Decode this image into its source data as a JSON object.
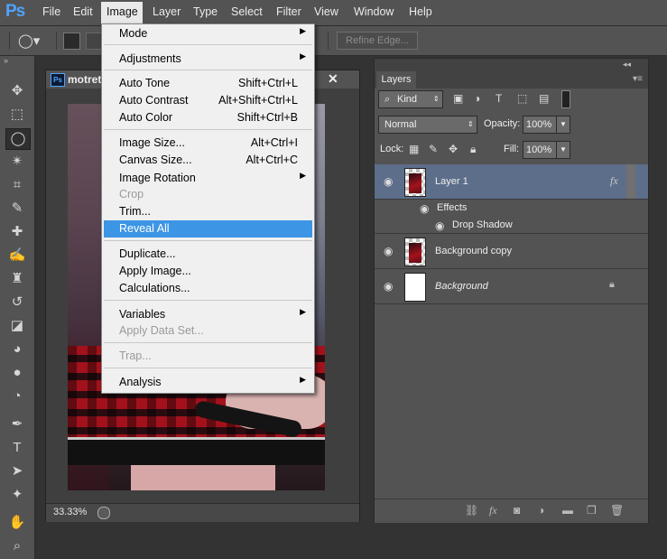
{
  "app": {
    "logo": "Ps"
  },
  "menubar": {
    "items": [
      "File",
      "Edit",
      "Image",
      "Layer",
      "Type",
      "Select",
      "Filter",
      "View",
      "Window",
      "Help"
    ],
    "active": "Image"
  },
  "options_bar": {
    "refine_edge": "Refine Edge..."
  },
  "document": {
    "title": "motret",
    "close": "✕",
    "zoom": "33.33%"
  },
  "image_menu": {
    "items": [
      {
        "label": "Mode",
        "submenu": true
      },
      {
        "label": "Adjustments",
        "submenu": true
      },
      {
        "label": "Auto Tone",
        "shortcut": "Shift+Ctrl+L"
      },
      {
        "label": "Auto Contrast",
        "shortcut": "Alt+Shift+Ctrl+L"
      },
      {
        "label": "Auto Color",
        "shortcut": "Shift+Ctrl+B"
      },
      {
        "label": "Image Size...",
        "shortcut": "Alt+Ctrl+I"
      },
      {
        "label": "Canvas Size...",
        "shortcut": "Alt+Ctrl+C"
      },
      {
        "label": "Image Rotation",
        "submenu": true
      },
      {
        "label": "Crop",
        "disabled": true
      },
      {
        "label": "Trim..."
      },
      {
        "label": "Reveal All",
        "highlighted": true
      },
      {
        "label": "Duplicate..."
      },
      {
        "label": "Apply Image..."
      },
      {
        "label": "Calculations..."
      },
      {
        "label": "Variables",
        "submenu": true
      },
      {
        "label": "Apply Data Set...",
        "disabled": true
      },
      {
        "label": "Trap...",
        "disabled": true
      },
      {
        "label": "Analysis",
        "submenu": true
      }
    ]
  },
  "layers_panel": {
    "tab": "Layers",
    "filter_kind": "Kind",
    "blend_mode": "Normal",
    "opacity_label": "Opacity:",
    "opacity_value": "100%",
    "lock_label": "Lock:",
    "fill_label": "Fill:",
    "fill_value": "100%",
    "layers": [
      {
        "name": "Layer 1",
        "selected": true,
        "fx": "fx"
      },
      {
        "name": "Background copy"
      },
      {
        "name": "Background",
        "italic": true,
        "locked": true
      }
    ],
    "effects_label": "Effects",
    "effect_name": "Drop Shadow"
  },
  "colors": {
    "menu_highlight": "#3d95e5",
    "selected_layer": "#5d6e8a",
    "ps_blue": "#4fa3ff"
  }
}
